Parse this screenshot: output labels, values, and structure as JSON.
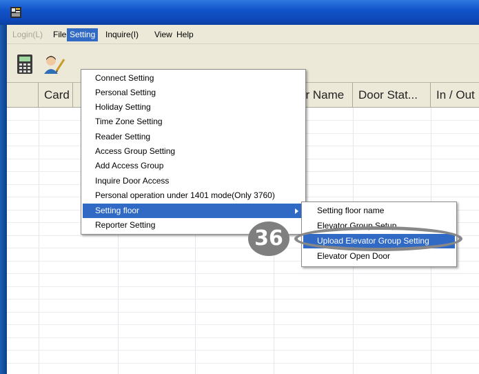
{
  "menubar": {
    "items": [
      "Login(L)",
      "File",
      "Setting",
      "Inquire(I)",
      "View",
      "Help"
    ]
  },
  "toolbar": {
    "buttons": [
      "calculator-icon",
      "user-edit-icon"
    ]
  },
  "grid": {
    "columns": [
      "Card",
      "or Name",
      "Door Stat...",
      "In / Out"
    ]
  },
  "setting_menu": {
    "items": [
      "Connect Setting",
      "Personal Setting",
      "Holiday Setting",
      "Time Zone Setting",
      "Reader Setting",
      "Access Group Setting",
      "Add Access Group",
      "Inquire Door Access",
      "Personal operation under 1401 mode(Only 3760)",
      "Setting floor",
      "Reporter Setting"
    ]
  },
  "floor_submenu": {
    "items": [
      "Setting floor name",
      "Elevator Group Setup",
      "Upload Elevator Group Setting",
      "Elevator Open Door"
    ]
  },
  "callout": {
    "number": "36"
  },
  "colors": {
    "titlebar": "#1254c9",
    "highlight": "#316ac5",
    "menubar": "#ece9d8"
  }
}
